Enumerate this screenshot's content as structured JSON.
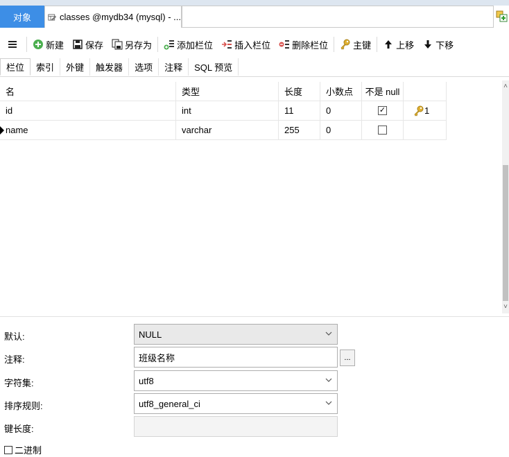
{
  "tabs": {
    "objects_label": "对象",
    "active_label": "classes @mydb34 (mysql) - ..."
  },
  "toolbar": {
    "new": "新建",
    "save": "保存",
    "save_as": "另存为",
    "add_field": "添加栏位",
    "insert_field": "插入栏位",
    "delete_field": "删除栏位",
    "primary_key": "主键",
    "move_up": "上移",
    "move_down": "下移"
  },
  "subtabs": [
    "栏位",
    "索引",
    "外键",
    "触发器",
    "选项",
    "注释",
    "SQL 预览"
  ],
  "grid": {
    "headers": [
      "名",
      "类型",
      "长度",
      "小数点",
      "不是 null",
      ""
    ],
    "rows": [
      {
        "name": "id",
        "type": "int",
        "length": "11",
        "decimals": "0",
        "not_null": true,
        "key": "1"
      },
      {
        "name": "name",
        "type": "varchar",
        "length": "255",
        "decimals": "0",
        "not_null": false,
        "key": ""
      }
    ]
  },
  "props": {
    "default_label": "默认:",
    "default_value": "NULL",
    "comment_label": "注释:",
    "comment_value": "班级名称",
    "comment_btn": "...",
    "charset_label": "字符集:",
    "charset_value": "utf8",
    "collation_label": "排序规则:",
    "collation_value": "utf8_general_ci",
    "keylen_label": "键长度:",
    "keylen_value": "",
    "binary_label": "二进制",
    "binary_checked": false
  },
  "colors": {
    "accent": "#3d8ee6",
    "key_gold": "#e0b030",
    "add_green": "#4caf50",
    "delete_red": "#d9534f"
  }
}
